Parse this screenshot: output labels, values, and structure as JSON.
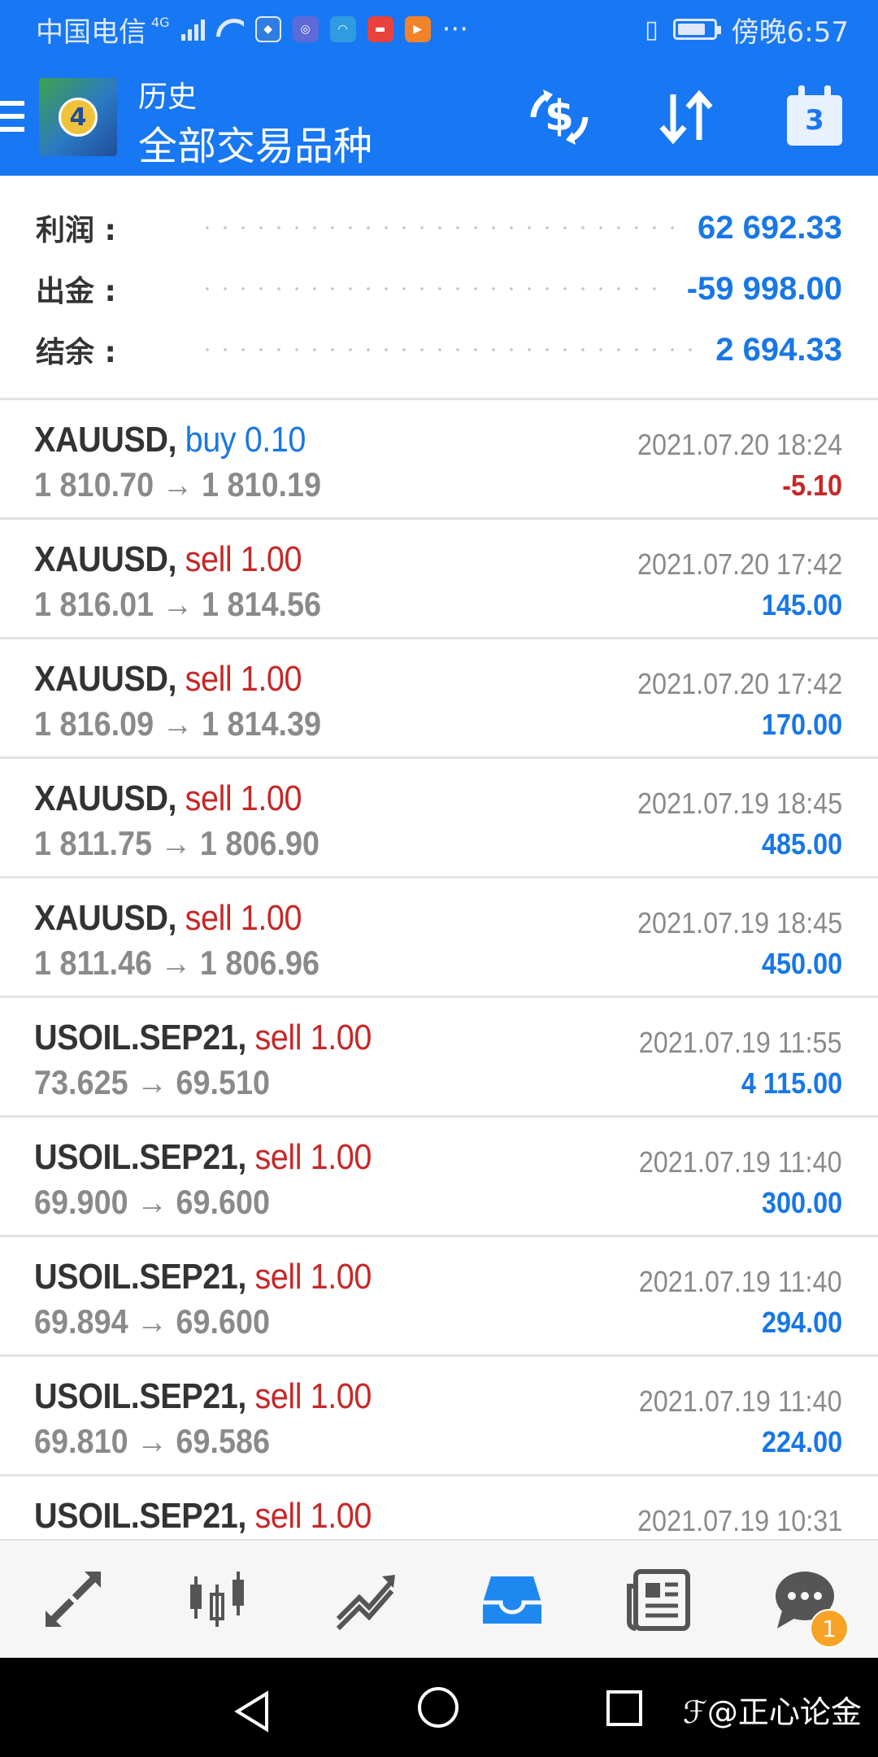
{
  "status_bar": {
    "carrier": "中国电信",
    "network": "4G",
    "time": "傍晚6:57"
  },
  "app_bar": {
    "subtitle": "历史",
    "title": "全部交易品种",
    "logo_text": "4"
  },
  "summary": {
    "profit_label": "利润 :",
    "profit_value": "62 692.33",
    "withdrawal_label": "出金 :",
    "withdrawal_value": "-59 998.00",
    "balance_label": "结余 :",
    "balance_value": "2 694.33"
  },
  "trades": [
    {
      "symbol": "XAUUSD,",
      "side": "buy 0.10",
      "prices": "1 810.70 → 1 810.19",
      "time": "2021.07.20 18:24",
      "profit": "-5.10"
    },
    {
      "symbol": "XAUUSD,",
      "side": "sell 1.00",
      "prices": "1 816.01 → 1 814.56",
      "time": "2021.07.20 17:42",
      "profit": "145.00"
    },
    {
      "symbol": "XAUUSD,",
      "side": "sell 1.00",
      "prices": "1 816.09 → 1 814.39",
      "time": "2021.07.20 17:42",
      "profit": "170.00"
    },
    {
      "symbol": "XAUUSD,",
      "side": "sell 1.00",
      "prices": "1 811.75 → 1 806.90",
      "time": "2021.07.19 18:45",
      "profit": "485.00"
    },
    {
      "symbol": "XAUUSD,",
      "side": "sell 1.00",
      "prices": "1 811.46 → 1 806.96",
      "time": "2021.07.19 18:45",
      "profit": "450.00"
    },
    {
      "symbol": "USOIL.SEP21,",
      "side": "sell 1.00",
      "prices": "73.625 → 69.510",
      "time": "2021.07.19 11:55",
      "profit": "4 115.00"
    },
    {
      "symbol": "USOIL.SEP21,",
      "side": "sell 1.00",
      "prices": "69.900 → 69.600",
      "time": "2021.07.19 11:40",
      "profit": "300.00"
    },
    {
      "symbol": "USOIL.SEP21,",
      "side": "sell 1.00",
      "prices": "69.894 → 69.600",
      "time": "2021.07.19 11:40",
      "profit": "294.00"
    },
    {
      "symbol": "USOIL.SEP21,",
      "side": "sell 1.00",
      "prices": "69.810 → 69.586",
      "time": "2021.07.19 11:40",
      "profit": "224.00"
    },
    {
      "symbol": "USOIL.SEP21,",
      "side": "sell 1.00",
      "prices": "",
      "time": "2021.07.19 10:31",
      "profit": ""
    }
  ],
  "bottom_nav": {
    "items": [
      "trade-quotes-icon",
      "chart-icon",
      "trade-icon",
      "history-icon",
      "news-icon",
      "messages-icon"
    ],
    "messages_badge": "1",
    "active": "history-icon"
  },
  "watermark": "@正心论金",
  "colors": {
    "brand": "#1877f2",
    "profit_positive": "#1877e6",
    "sell_red": "#c62828",
    "muted": "#8a8a8a"
  }
}
